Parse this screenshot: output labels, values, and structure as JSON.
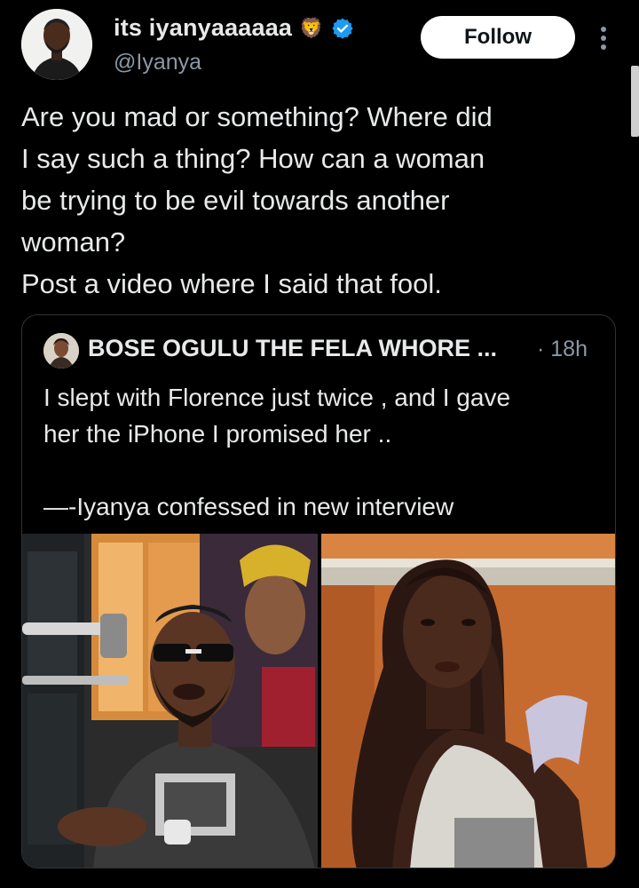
{
  "author": {
    "display_name": "its iyanyaaaaaa",
    "name_emoji": "🦁",
    "handle": "@Iyanya",
    "verified_badge_color": "#1d9bf0"
  },
  "actions": {
    "follow_label": "Follow",
    "more_icon": "vertical-dots-icon"
  },
  "tweet": {
    "lines": [
      "Are you mad or something? Where did",
      "I say such a thing? How can a woman",
      "be trying to be evil towards another",
      "woman?",
      "Post a video where I said that fool."
    ]
  },
  "quoted": {
    "author_name": "BOSE OGULU THE FELA WHORE ...",
    "time": "· 18h",
    "lines": [
      "I slept with Florence just twice , and I gave",
      "her the iPhone I promised her ..",
      "",
      "—-Iyanya confessed in new interview"
    ],
    "media": [
      {
        "description": "man-in-studio-photo"
      },
      {
        "description": "woman-selfie-photo"
      }
    ]
  },
  "colors": {
    "background": "#000000",
    "text": "#e7e9ea",
    "secondary": "#8b98a5",
    "border": "#2f3336"
  }
}
